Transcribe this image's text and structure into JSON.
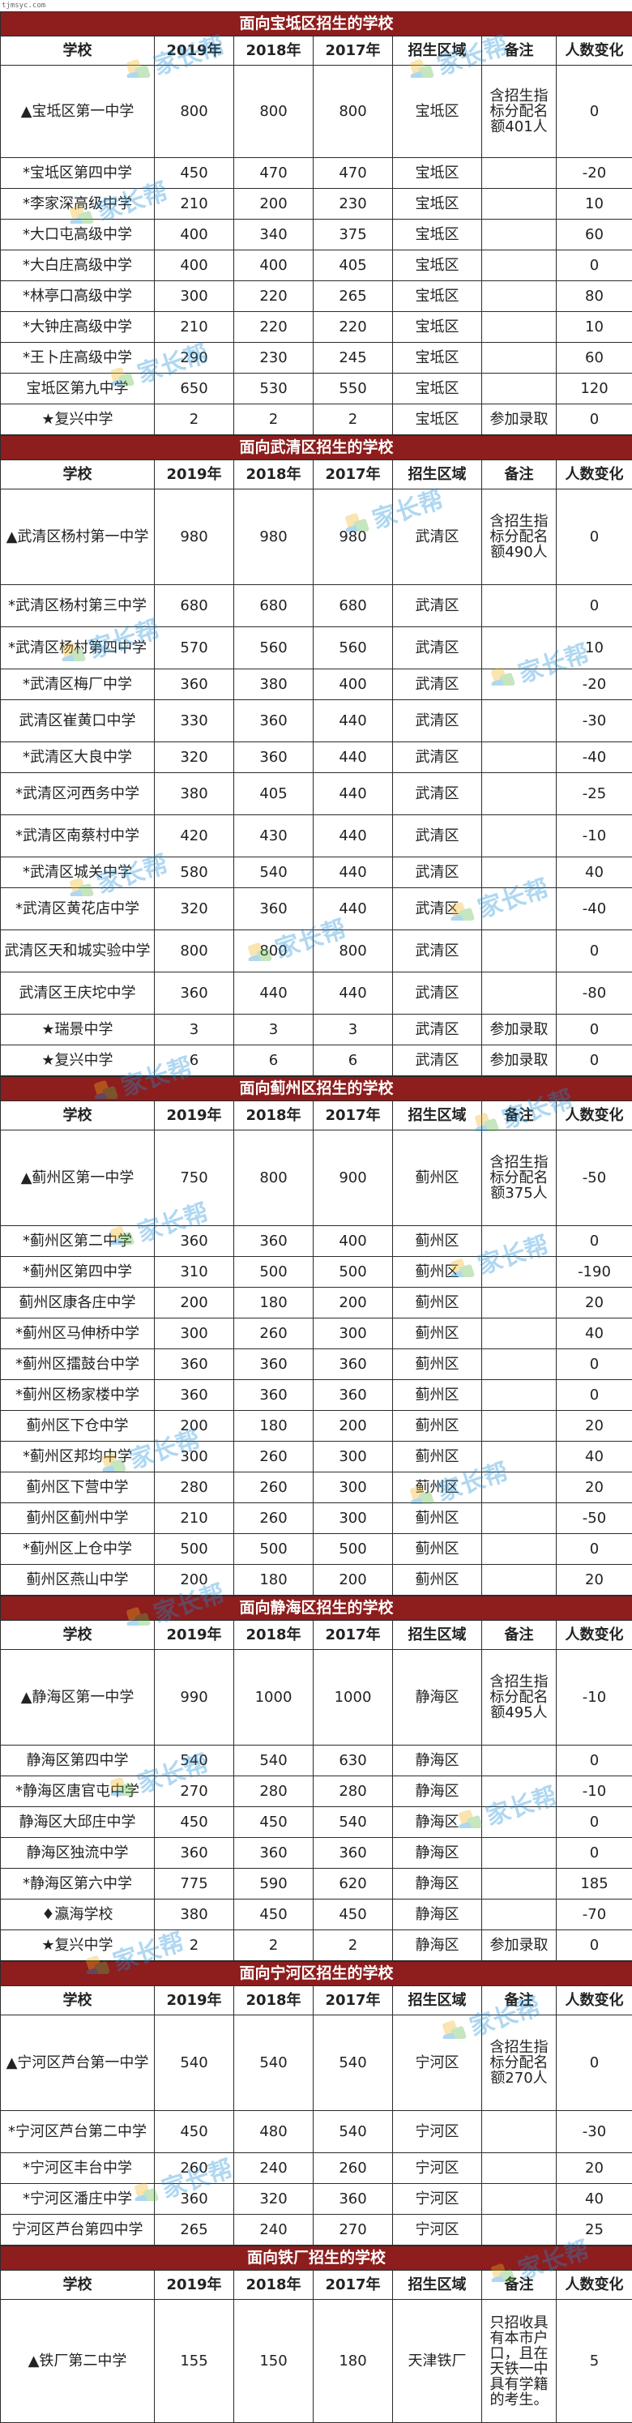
{
  "site": "tjmsyc.com",
  "watermark": "家长帮",
  "colors": {
    "title_bg": "#8e1d1d",
    "title_fg": "#ffffff",
    "watermark_blue": "#1e8fd8",
    "watermark_yellow": "#f2b51c",
    "watermark_green": "#5cb848"
  },
  "sections": [
    {
      "title": "面向宝坻区招生的学校",
      "headers": [
        "学校",
        "2019年",
        "2018年",
        "2017年",
        "招生区域",
        "备注",
        "人数变化"
      ],
      "rows": [
        {
          "h": 114,
          "cells": [
            "▲宝坻区第一中学",
            "800",
            "800",
            "800",
            "宝坻区",
            "含招生指标分配名额401人",
            "0"
          ]
        },
        {
          "h": 38,
          "cells": [
            "*宝坻区第四中学",
            "450",
            "470",
            "470",
            "宝坻区",
            "",
            "-20"
          ]
        },
        {
          "h": 38,
          "cells": [
            "*李家深高级中学",
            "210",
            "200",
            "230",
            "宝坻区",
            "",
            "10"
          ]
        },
        {
          "h": 38,
          "cells": [
            "*大口屯高级中学",
            "400",
            "340",
            "375",
            "宝坻区",
            "",
            "60"
          ]
        },
        {
          "h": 38,
          "cells": [
            "*大白庄高级中学",
            "400",
            "400",
            "405",
            "宝坻区",
            "",
            "0"
          ]
        },
        {
          "h": 38,
          "cells": [
            "*林亭口高级中学",
            "300",
            "220",
            "265",
            "宝坻区",
            "",
            "80"
          ]
        },
        {
          "h": 38,
          "cells": [
            "*大钟庄高级中学",
            "210",
            "220",
            "220",
            "宝坻区",
            "",
            "10"
          ]
        },
        {
          "h": 38,
          "cells": [
            "*王卜庄高级中学",
            "290",
            "230",
            "245",
            "宝坻区",
            "",
            "60"
          ]
        },
        {
          "h": 38,
          "cells": [
            "宝坻区第九中学",
            "650",
            "530",
            "550",
            "宝坻区",
            "",
            "120"
          ]
        },
        {
          "h": 38,
          "cells": [
            "★复兴中学",
            "2",
            "2",
            "2",
            "宝坻区",
            "参加录取",
            "0"
          ]
        }
      ]
    },
    {
      "title": "面向武清区招生的学校",
      "headers": [
        "学校",
        "2019年",
        "2018年",
        "2017年",
        "招生区域",
        "备注",
        "人数变化"
      ],
      "rows": [
        {
          "h": 118,
          "cells": [
            "▲武清区杨村第一中学",
            "980",
            "980",
            "980",
            "武清区",
            "含招生指标分配名额490人",
            "0"
          ]
        },
        {
          "h": 52,
          "cells": [
            "*武清区杨村第三中学",
            "680",
            "680",
            "680",
            "武清区",
            "",
            "0"
          ]
        },
        {
          "h": 52,
          "cells": [
            "*武清区杨村第四中学",
            "570",
            "560",
            "560",
            "武清区",
            "",
            "10"
          ]
        },
        {
          "h": 38,
          "cells": [
            "*武清区梅厂中学",
            "360",
            "380",
            "400",
            "武清区",
            "",
            "-20"
          ]
        },
        {
          "h": 52,
          "cells": [
            "武清区崔黄口中学",
            "330",
            "360",
            "440",
            "武清区",
            "",
            "-30"
          ]
        },
        {
          "h": 38,
          "cells": [
            "*武清区大良中学",
            "320",
            "360",
            "440",
            "武清区",
            "",
            "-40"
          ]
        },
        {
          "h": 52,
          "cells": [
            "*武清区河西务中学",
            "380",
            "405",
            "440",
            "武清区",
            "",
            "-25"
          ]
        },
        {
          "h": 52,
          "cells": [
            "*武清区南蔡村中学",
            "420",
            "430",
            "440",
            "武清区",
            "",
            "-10"
          ]
        },
        {
          "h": 38,
          "cells": [
            "*武清区城关中学",
            "580",
            "540",
            "440",
            "武清区",
            "",
            "40"
          ]
        },
        {
          "h": 52,
          "cells": [
            "*武清区黄花店中学",
            "320",
            "360",
            "440",
            "武清区",
            "",
            "-40"
          ]
        },
        {
          "h": 52,
          "cells": [
            "武清区天和城实验中学",
            "800",
            "800",
            "800",
            "武清区",
            "",
            "0"
          ]
        },
        {
          "h": 52,
          "cells": [
            "武清区王庆坨中学",
            "360",
            "440",
            "440",
            "武清区",
            "",
            "-80"
          ]
        },
        {
          "h": 38,
          "cells": [
            "★瑞景中学",
            "3",
            "3",
            "3",
            "武清区",
            "参加录取",
            "0"
          ]
        },
        {
          "h": 38,
          "cells": [
            "★复兴中学",
            "6",
            "6",
            "6",
            "武清区",
            "参加录取",
            "0"
          ]
        }
      ]
    },
    {
      "title": "面向蓟州区招生的学校",
      "headers": [
        "学校",
        "2019年",
        "2018年",
        "2017年",
        "招生区域",
        "备注",
        "人数变化"
      ],
      "rows": [
        {
          "h": 118,
          "cells": [
            "▲蓟州区第一中学",
            "750",
            "800",
            "900",
            "蓟州区",
            "含招生指标分配名额375人",
            "-50"
          ]
        },
        {
          "h": 38,
          "cells": [
            "*蓟州区第二中学",
            "360",
            "360",
            "400",
            "蓟州区",
            "",
            "0"
          ]
        },
        {
          "h": 38,
          "cells": [
            "*蓟州区第四中学",
            "310",
            "500",
            "500",
            "蓟州区",
            "",
            "-190"
          ]
        },
        {
          "h": 38,
          "cells": [
            "蓟州区康各庄中学",
            "200",
            "180",
            "200",
            "蓟州区",
            "",
            "20"
          ]
        },
        {
          "h": 38,
          "cells": [
            "*蓟州区马伸桥中学",
            "300",
            "260",
            "300",
            "蓟州区",
            "",
            "40"
          ]
        },
        {
          "h": 38,
          "cells": [
            "*蓟州区擂鼓台中学",
            "360",
            "360",
            "360",
            "蓟州区",
            "",
            "0"
          ]
        },
        {
          "h": 38,
          "cells": [
            "*蓟州区杨家楼中学",
            "360",
            "360",
            "360",
            "蓟州区",
            "",
            "0"
          ]
        },
        {
          "h": 38,
          "cells": [
            "蓟州区下仓中学",
            "200",
            "180",
            "200",
            "蓟州区",
            "",
            "20"
          ]
        },
        {
          "h": 38,
          "cells": [
            "*蓟州区邦均中学",
            "300",
            "260",
            "300",
            "蓟州区",
            "",
            "40"
          ]
        },
        {
          "h": 38,
          "cells": [
            "蓟州区下营中学",
            "280",
            "260",
            "300",
            "蓟州区",
            "",
            "20"
          ]
        },
        {
          "h": 38,
          "cells": [
            "蓟州区蓟州中学",
            "210",
            "260",
            "300",
            "蓟州区",
            "",
            "-50"
          ]
        },
        {
          "h": 38,
          "cells": [
            "*蓟州区上仓中学",
            "500",
            "500",
            "500",
            "蓟州区",
            "",
            "0"
          ]
        },
        {
          "h": 38,
          "cells": [
            "蓟州区燕山中学",
            "200",
            "180",
            "200",
            "蓟州区",
            "",
            "20"
          ]
        }
      ]
    },
    {
      "title": "面向静海区招生的学校",
      "headers": [
        "学校",
        "2019年",
        "2018年",
        "2017年",
        "招生区域",
        "备注",
        "人数变化"
      ],
      "rows": [
        {
          "h": 118,
          "cells": [
            "▲静海区第一中学",
            "990",
            "1000",
            "1000",
            "静海区",
            "含招生指标分配名额495人",
            "-10"
          ]
        },
        {
          "h": 38,
          "cells": [
            "静海区第四中学",
            "540",
            "540",
            "630",
            "静海区",
            "",
            "0"
          ]
        },
        {
          "h": 38,
          "cells": [
            "*静海区唐官屯中学",
            "270",
            "280",
            "280",
            "静海区",
            "",
            "-10"
          ]
        },
        {
          "h": 38,
          "cells": [
            "静海区大邱庄中学",
            "450",
            "450",
            "540",
            "静海区",
            "",
            "0"
          ]
        },
        {
          "h": 38,
          "cells": [
            "静海区独流中学",
            "360",
            "360",
            "360",
            "静海区",
            "",
            "0"
          ]
        },
        {
          "h": 38,
          "cells": [
            "*静海区第六中学",
            "775",
            "590",
            "620",
            "静海区",
            "",
            "185"
          ]
        },
        {
          "h": 38,
          "cells": [
            "♦瀛海学校",
            "380",
            "450",
            "450",
            "静海区",
            "",
            "-70"
          ]
        },
        {
          "h": 38,
          "cells": [
            "★复兴中学",
            "2",
            "2",
            "2",
            "静海区",
            "参加录取",
            "0"
          ]
        }
      ]
    },
    {
      "title": "面向宁河区招生的学校",
      "headers": [
        "学校",
        "2019年",
        "2018年",
        "2017年",
        "招生区域",
        "备注",
        "人数变化"
      ],
      "rows": [
        {
          "h": 118,
          "cells": [
            "▲宁河区芦台第一中学",
            "540",
            "540",
            "540",
            "宁河区",
            "含招生指标分配名额270人",
            "0"
          ]
        },
        {
          "h": 52,
          "cells": [
            "*宁河区芦台第二中学",
            "450",
            "480",
            "540",
            "宁河区",
            "",
            "-30"
          ]
        },
        {
          "h": 38,
          "cells": [
            "*宁河区丰台中学",
            "260",
            "240",
            "260",
            "宁河区",
            "",
            "20"
          ]
        },
        {
          "h": 38,
          "cells": [
            "*宁河区潘庄中学",
            "360",
            "320",
            "360",
            "宁河区",
            "",
            "40"
          ]
        },
        {
          "h": 38,
          "cells": [
            "宁河区芦台第四中学",
            "265",
            "240",
            "270",
            "宁河区",
            "",
            "25"
          ]
        }
      ]
    },
    {
      "title": "面向铁厂招生的学校",
      "headers": [
        "学校",
        "2019年",
        "2018年",
        "2017年",
        "招生区域",
        "备注",
        "人数变化"
      ],
      "rows": [
        {
          "h": 152,
          "cells": [
            "▲铁厂第二中学",
            "155",
            "150",
            "180",
            "天津铁厂",
            "只招收具有本市户口，且在天铁一中具有学籍的考生。",
            "5"
          ]
        }
      ]
    }
  ]
}
